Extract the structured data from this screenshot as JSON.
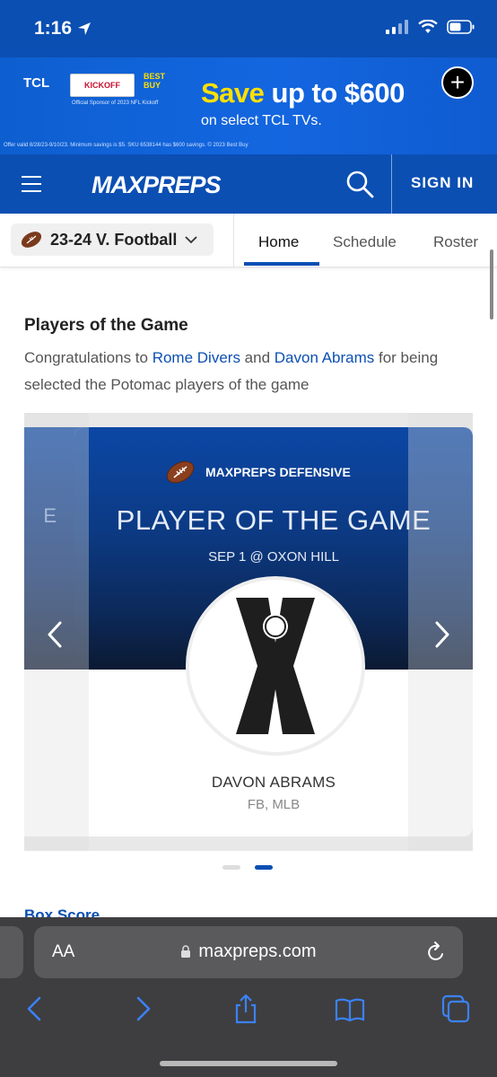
{
  "status_bar": {
    "time": "1:16"
  },
  "ad": {
    "brand": "TCL",
    "kickoff": "KICKOFF",
    "partner": "BEST BUY",
    "sponsor_line": "Official Sponsor of 2023 NFL Kickoff",
    "headline_save": "Save",
    "headline_rest": " up to $600",
    "subline": "on select TCL TVs.",
    "legal": "Offer valid 8/28/23-9/10/23. Minimum savings is $5. SKU 6538144 has $600 savings. © 2023 Best Buy"
  },
  "nav": {
    "logo": "MAXPREPS",
    "signin_label": "SIGN IN"
  },
  "sub_nav": {
    "team_label": "23-24 V. Football",
    "tabs": [
      {
        "label": "Home"
      },
      {
        "label": "Schedule"
      },
      {
        "label": "Roster"
      }
    ]
  },
  "section": {
    "title": "Players of the Game",
    "desc_prefix": "Congratulations to ",
    "player1": "Rome Divers",
    "desc_and": " and ",
    "player2": "Davon Abrams",
    "desc_suffix": " for being selected the Potomac players of the game"
  },
  "card": {
    "brand": "MAXPREPS DEFENSIVE",
    "title": "PLAYER OF THE GAME",
    "date": "SEP 1 @ OXON HILL",
    "player_name": "DAVON ABRAMS",
    "positions": "FB, MLB",
    "prev_fragment": "E"
  },
  "next_section": {
    "title": "Box Score"
  },
  "browser": {
    "aa_label": "AA",
    "url": "maxpreps.com"
  },
  "colors": {
    "brand_blue": "#0b4fb3",
    "ad_yellow": "#ffe000",
    "browser_gray": "#3e3e40"
  }
}
